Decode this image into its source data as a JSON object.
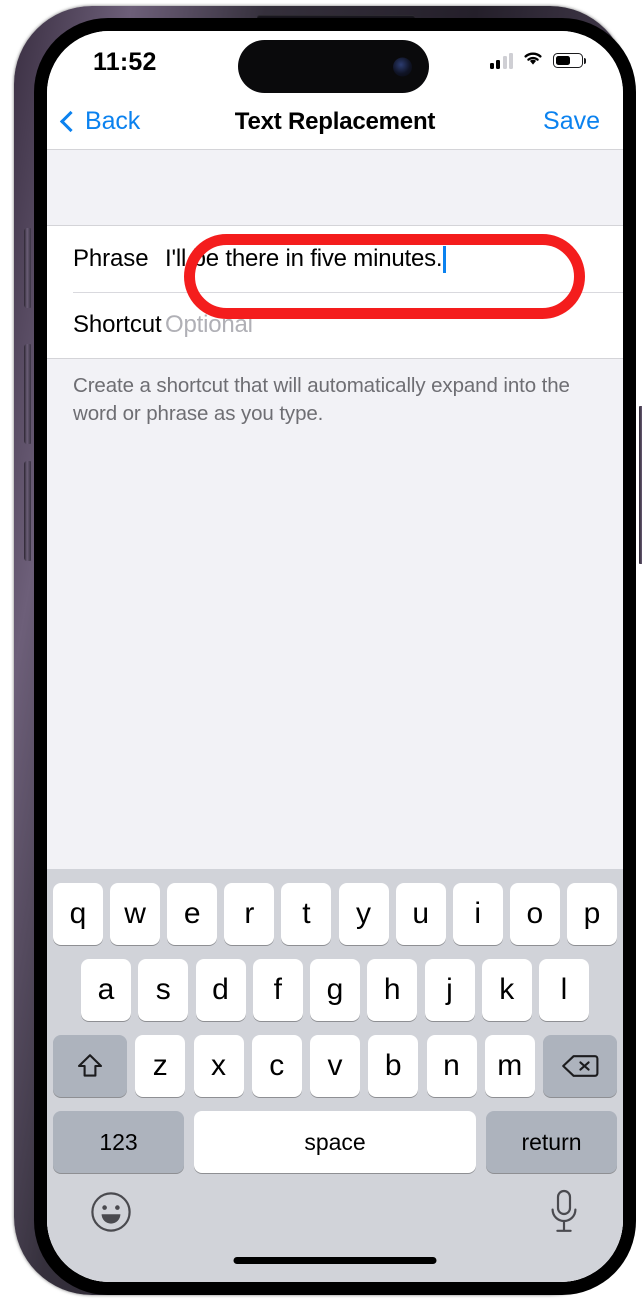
{
  "status_bar": {
    "time": "11:52",
    "cellular_icon": "cellular-signal-icon",
    "cellular_bars_filled": 2,
    "cellular_bars_total": 4,
    "wifi_icon": "wifi-icon",
    "battery_icon": "battery-icon",
    "battery_level_percent": 55
  },
  "nav_bar": {
    "back_label": "Back",
    "back_icon": "chevron-left-icon",
    "title": "Text Replacement",
    "save_label": "Save"
  },
  "form": {
    "rows": [
      {
        "label": "Phrase",
        "value": "I'll be there in five minutes.",
        "placeholder": "",
        "focused": true
      },
      {
        "label": "Shortcut",
        "value": "",
        "placeholder": "Optional",
        "focused": false
      }
    ],
    "footer_note": "Create a shortcut that will automatically expand into the word or phrase as you type."
  },
  "annotation": {
    "shape": "oval-highlight",
    "color": "#f41d1d",
    "target": "phrase-value-field"
  },
  "keyboard": {
    "row1": [
      "q",
      "w",
      "e",
      "r",
      "t",
      "y",
      "u",
      "i",
      "o",
      "p"
    ],
    "row2": [
      "a",
      "s",
      "d",
      "f",
      "g",
      "h",
      "j",
      "k",
      "l"
    ],
    "row3": [
      "z",
      "x",
      "c",
      "v",
      "b",
      "n",
      "m"
    ],
    "shift_icon": "shift-arrow-up-icon",
    "delete_icon": "backspace-delete-icon",
    "numbers_label": "123",
    "space_label": "space",
    "return_label": "return",
    "emoji_icon": "emoji-smiley-icon",
    "dictation_icon": "microphone-icon"
  },
  "colors": {
    "accent": "#0b82ef",
    "annotation": "#f41d1d",
    "screen_background": "#f2f2f6",
    "keyboard_background": "#d1d3d9",
    "key_light": "#ffffff",
    "key_dark": "#adb3bd"
  }
}
